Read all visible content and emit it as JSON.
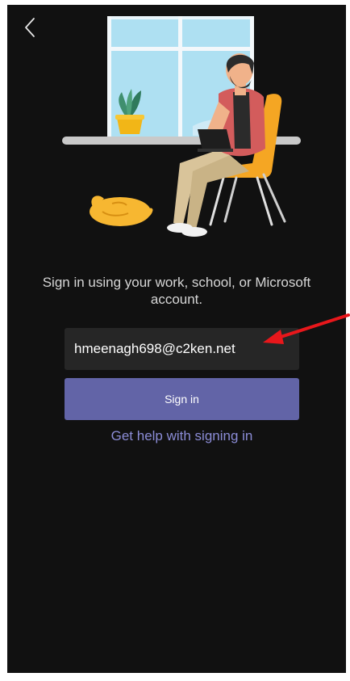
{
  "signin": {
    "prompt": "Sign in using your work, school, or Microsoft account.",
    "email_value": "hmeenagh698@c2ken.net",
    "signin_label": "Sign in",
    "help_label": "Get help with signing in"
  },
  "icons": {
    "back": "chevron-left-icon",
    "annotation": "arrow-icon"
  },
  "colors": {
    "background": "#111111",
    "field_bg": "#262626",
    "button_bg": "#6264a7",
    "link": "#8b8cd6",
    "annotation": "#e8171b"
  }
}
